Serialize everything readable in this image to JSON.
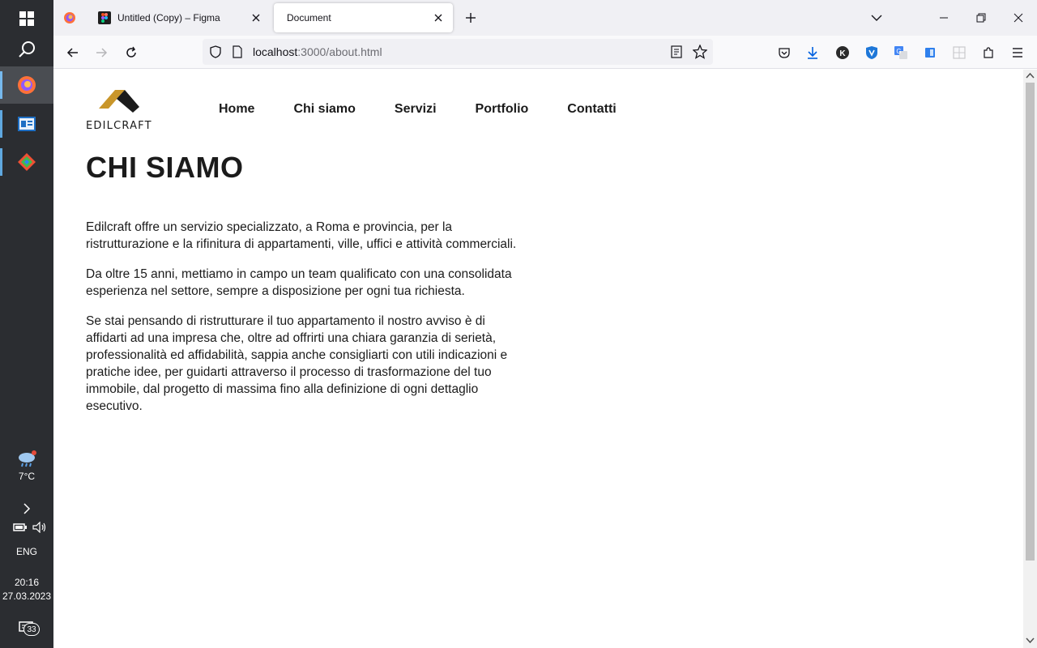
{
  "taskbar": {
    "weather_temp": "7°C",
    "language": "ENG",
    "time": "20:16",
    "date": "27.03.2023",
    "notifications": "33"
  },
  "browser": {
    "tabs": [
      {
        "title": "",
        "icon": "firefox-icon"
      },
      {
        "title": "Untitled (Copy) – Figma",
        "icon": "figma-icon"
      },
      {
        "title": "Document",
        "active": true
      }
    ],
    "url_host": "localhost",
    "url_path": ":3000/about.html"
  },
  "site": {
    "logo_text": "EDILCRAFT",
    "nav": [
      "Home",
      "Chi siamo",
      "Servizi",
      "Portfolio",
      "Contatti"
    ],
    "title": "CHI SIAMO",
    "paragraphs": [
      "Edilcraft offre un servizio specializzato, a Roma e provincia, per la ristrutturazione e la rifinitura di appartamenti, ville, uffici e attività commerciali.",
      "Da oltre 15 anni, mettiamo in campo un team qualificato con una consolidata esperienza nel settore, sempre a disposizione per ogni tua richiesta.",
      "Se stai pensando di ristrutturare il tuo appartamento il nostro avviso è di affidarti ad una impresa che, oltre ad offrirti una chiara garanzia di serietà, professionalità ed affidabilità, sappia anche consigliarti con utili indicazioni e pratiche idee, per guidarti attraverso il processo di trasformazione del tuo immobile, dal progetto di massima fino alla definizione di ogni dettaglio esecutivo."
    ]
  },
  "colors": {
    "logo_gold": "#c9962a",
    "logo_dark": "#1b1b1b"
  }
}
